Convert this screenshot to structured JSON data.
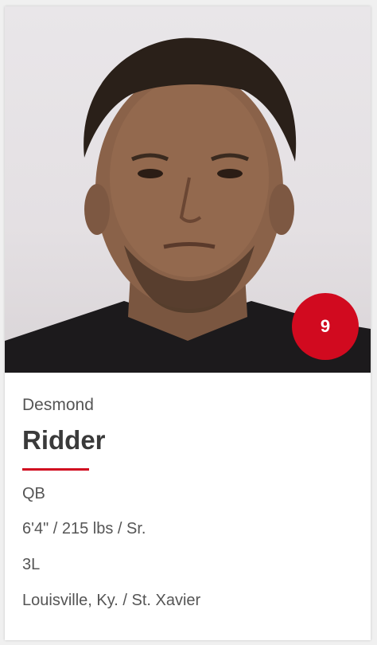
{
  "player": {
    "number": "9",
    "first_name": "Desmond",
    "last_name": "Ridder",
    "position": "QB",
    "height": "6'4\"",
    "weight": "/ 215 lbs",
    "class_year": "/ Sr.",
    "experience": "3L",
    "hometown": "Louisville, Ky.",
    "high_school": "/ St. Xavier"
  },
  "colors": {
    "accent": "#d10a1f",
    "text": "#555555",
    "card_bg": "#ffffff"
  }
}
